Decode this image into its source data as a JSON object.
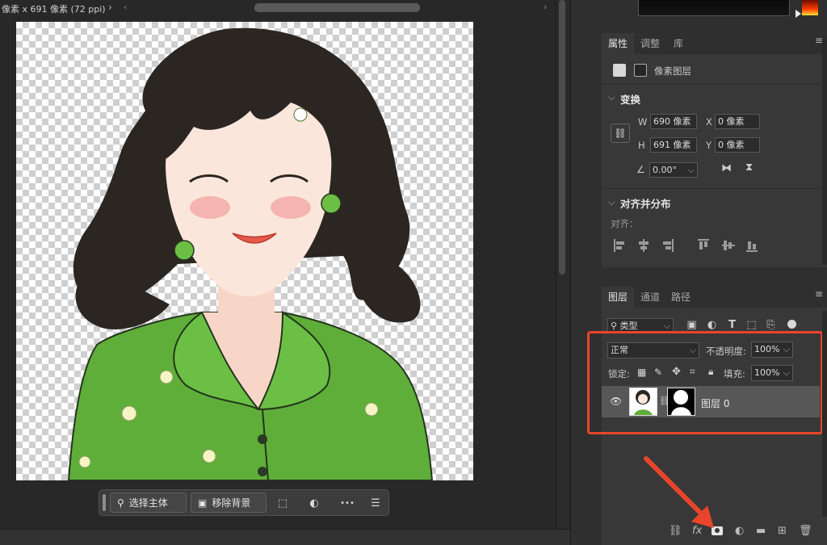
{
  "canvas": {
    "status": "像素 x 691 像素 (72 ppi)",
    "status_arrow": "›",
    "scroll_left": "‹",
    "scroll_right": "›"
  },
  "taskbar": {
    "select_subject": "选择主体",
    "remove_background": "移除背景",
    "more": "•••"
  },
  "properties": {
    "tabs": [
      "属性",
      "调整",
      "库"
    ],
    "layer_type": "像素图层",
    "transform_header": "变换",
    "w_label": "W",
    "w_value": "690 像素",
    "h_label": "H",
    "h_value": "691 像素",
    "x_label": "X",
    "x_value": "0 像素",
    "y_label": "Y",
    "y_value": "0 像素",
    "angle_value": "0.00°",
    "align_header": "对齐并分布",
    "align_label": "对齐："
  },
  "layers": {
    "tabs": [
      "图层",
      "通道",
      "路径"
    ],
    "filter_kind": "类型",
    "blend_mode": "正常",
    "opacity_label": "不透明度:",
    "opacity_value": "100%",
    "lock_label": "锁定:",
    "fill_label": "填充:",
    "fill_value": "100%",
    "layer_name": "图层 0",
    "fx_label": "fx"
  },
  "colors": {
    "highlight": "#e8452b",
    "shirt_green": "#5fae3a",
    "hair": "#2b2622"
  }
}
